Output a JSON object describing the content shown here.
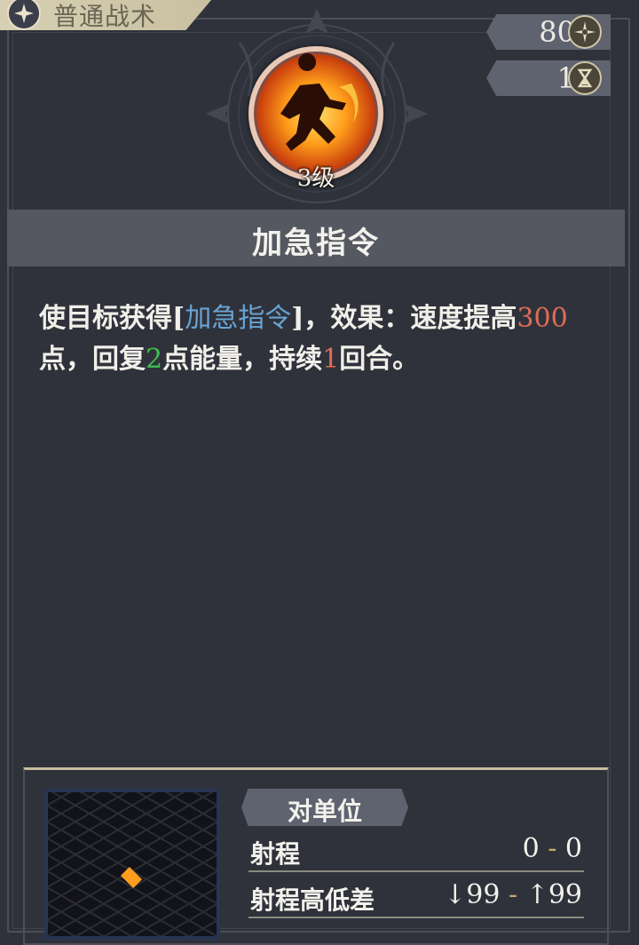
{
  "category": {
    "label": "普通战术",
    "icon": "compass-star-icon"
  },
  "stats": {
    "cost": {
      "value": "80",
      "icon": "star-burst-icon"
    },
    "cooldown": {
      "value": "1",
      "icon": "hourglass-icon"
    }
  },
  "skill": {
    "level": "3级",
    "name": "加急指令",
    "icon": "running-figure-flame-icon"
  },
  "description": {
    "part1": "使目标获得[",
    "keyword": "加急指令",
    "part2": "]，效果：速度提高",
    "speed_bonus": "300",
    "part3": "点，回复",
    "energy": "2",
    "part4": "点能量，持续",
    "duration": "1",
    "part5": "回合。"
  },
  "targeting": {
    "target_type": "对单位",
    "range_label": "射程",
    "range_min": "0",
    "range_sep": "-",
    "range_max": "0",
    "height_label": "射程高低差",
    "height_down": "↓99",
    "height_sep": "-",
    "height_up": "↑99"
  },
  "colors": {
    "keyword": "#6aa3d4",
    "number_red": "#e06c55",
    "number_green": "#3fbf4f",
    "background": "#2f323b"
  }
}
